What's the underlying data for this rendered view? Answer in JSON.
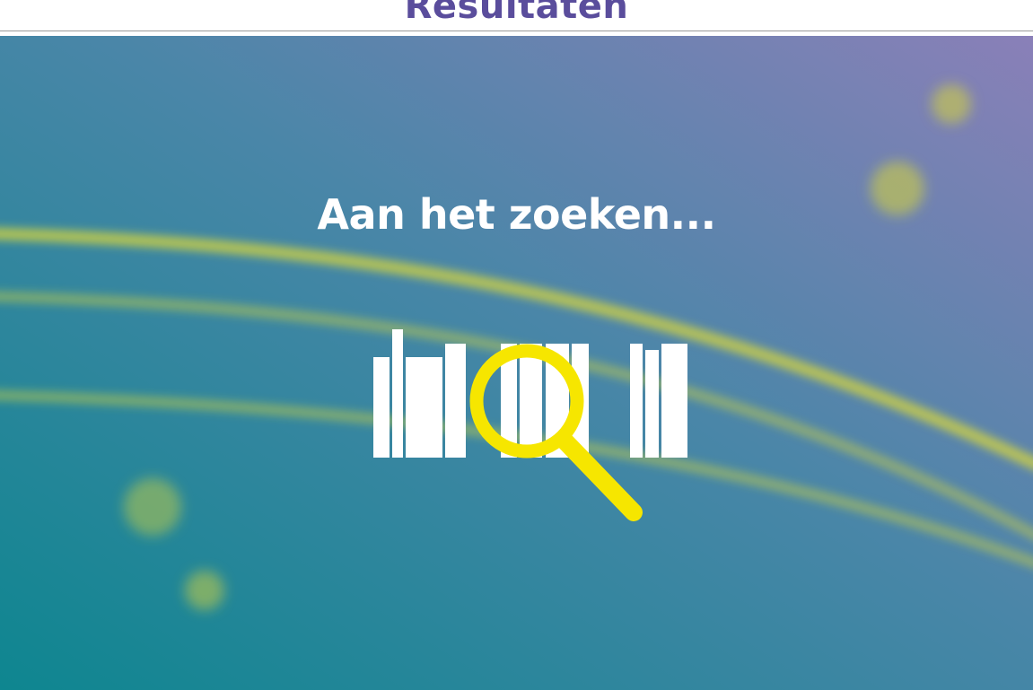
{
  "header": {
    "title": "Resultaten",
    "title_color": "#5a4d9c"
  },
  "main": {
    "loading_text": "Aan het zoeken...",
    "text_color": "#ffffff",
    "background": {
      "gradient_start": "#0e8690",
      "gradient_end": "#8a80b8",
      "accent_color": "#d7d63c"
    },
    "illustration": {
      "books_color": "#ffffff",
      "magnifier_color": "#f6e600",
      "icons": [
        "books-icon",
        "magnifying-glass-icon"
      ]
    }
  }
}
